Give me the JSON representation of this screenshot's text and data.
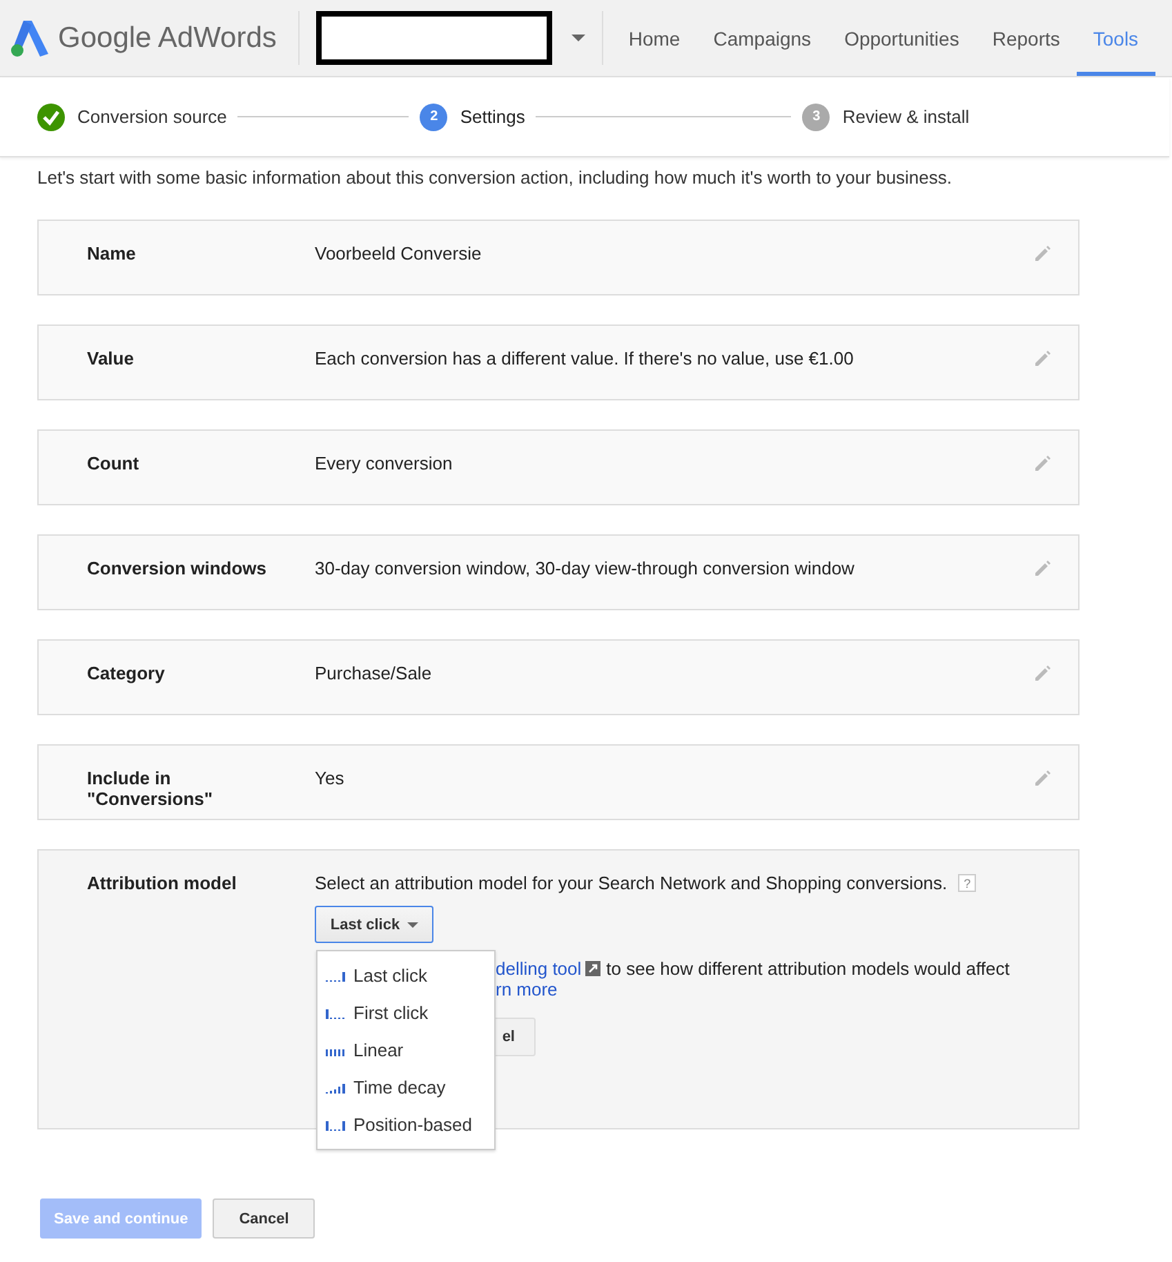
{
  "header": {
    "logo_text": "Google AdWords",
    "nav": [
      {
        "label": "Home",
        "selected": false
      },
      {
        "label": "Campaigns",
        "selected": false
      },
      {
        "label": "Opportunities",
        "selected": false
      },
      {
        "label": "Reports",
        "selected": false
      },
      {
        "label": "Tools",
        "selected": true
      }
    ]
  },
  "steps": [
    {
      "label": "Conversion source",
      "completed": true,
      "current": false
    },
    {
      "label": "Settings",
      "completed": false,
      "current": true,
      "number": "2"
    },
    {
      "label": "Review & install",
      "completed": false,
      "current": false,
      "number": "3"
    }
  ],
  "intro": "Let's start with some basic information about this conversion action, including how much it's worth to your business.",
  "settings": [
    {
      "label": "Name",
      "value": "Voorbeeld Conversie"
    },
    {
      "label": "Value",
      "value": "Each conversion has a different value. If there's no value, use €1.00"
    },
    {
      "label": "Count",
      "value": "Every conversion"
    },
    {
      "label": "Conversion windows",
      "value": "30-day conversion window, 30-day view-through conversion window"
    },
    {
      "label": "Category",
      "value": "Purchase/Sale"
    },
    {
      "label": "Include in \"Conversions\"",
      "value": "Yes"
    }
  ],
  "attribution": {
    "label": "Attribution model",
    "description": "Select an attribution model for your Search Network and Shopping conversions.",
    "help": "?",
    "dropdown": "Last click",
    "tool_link": "delling tool",
    "tool_text": "to see how different attribution models would affect",
    "learn_more": "rn more",
    "button_fragment": "el",
    "menu": [
      {
        "label": "Last click",
        "kind": "last"
      },
      {
        "label": "First click",
        "kind": "first"
      },
      {
        "label": "Linear",
        "kind": "linear"
      },
      {
        "label": "Time decay",
        "kind": "decay"
      },
      {
        "label": "Position-based",
        "kind": "position"
      }
    ]
  },
  "footer": {
    "save": "Save and continue",
    "save_disabled": true,
    "cancel": "Cancel"
  }
}
